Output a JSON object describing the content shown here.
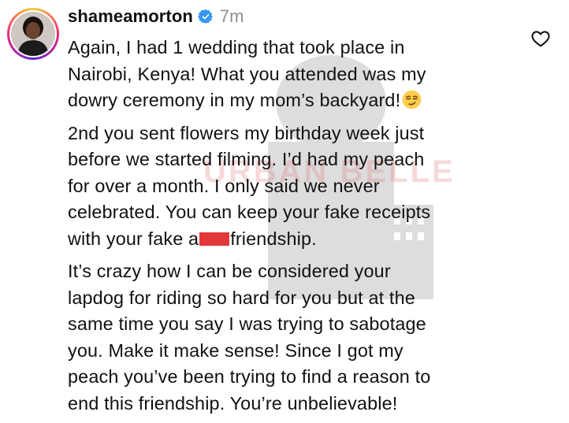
{
  "comment": {
    "username": "shameamorton",
    "timestamp": "7m",
    "verified": true,
    "like_icon": "heart-outline-icon",
    "verified_icon": "verified-badge-icon",
    "paragraphs": {
      "p1": {
        "l1": "Again, I had 1 wedding that took place in",
        "l2": "Nairobi, Kenya! What you attended was my",
        "l3": "dowry ceremony in my mom’s backyard!",
        "emoji": "smirking-face-emoji"
      },
      "p2": {
        "l1": "2nd you sent flowers my birthday week just",
        "l2": "before we started filming. I’d had my peach",
        "l3": "for over a month. I only said we never",
        "l4": "celebrated. You can keep your fake receipts",
        "l5a": "with your fake a",
        "l5b": "friendship."
      },
      "p3": {
        "l1": "It’s crazy how I can be considered your",
        "l2": "lapdog for riding so hard for you but at the",
        "l3": "same time you say I was trying to sabotage",
        "l4": "you. Make it make sense! Since I got my",
        "l5": "peach you’ve been trying to find a reason to",
        "l6": "end this friendship. You’re unbelievable!"
      }
    }
  },
  "watermark": {
    "text": "URBAN BELLE"
  },
  "colors": {
    "verified_blue": "#3897f0",
    "redaction_red": "#e2383a",
    "timestamp_gray": "#8e8e8e"
  }
}
